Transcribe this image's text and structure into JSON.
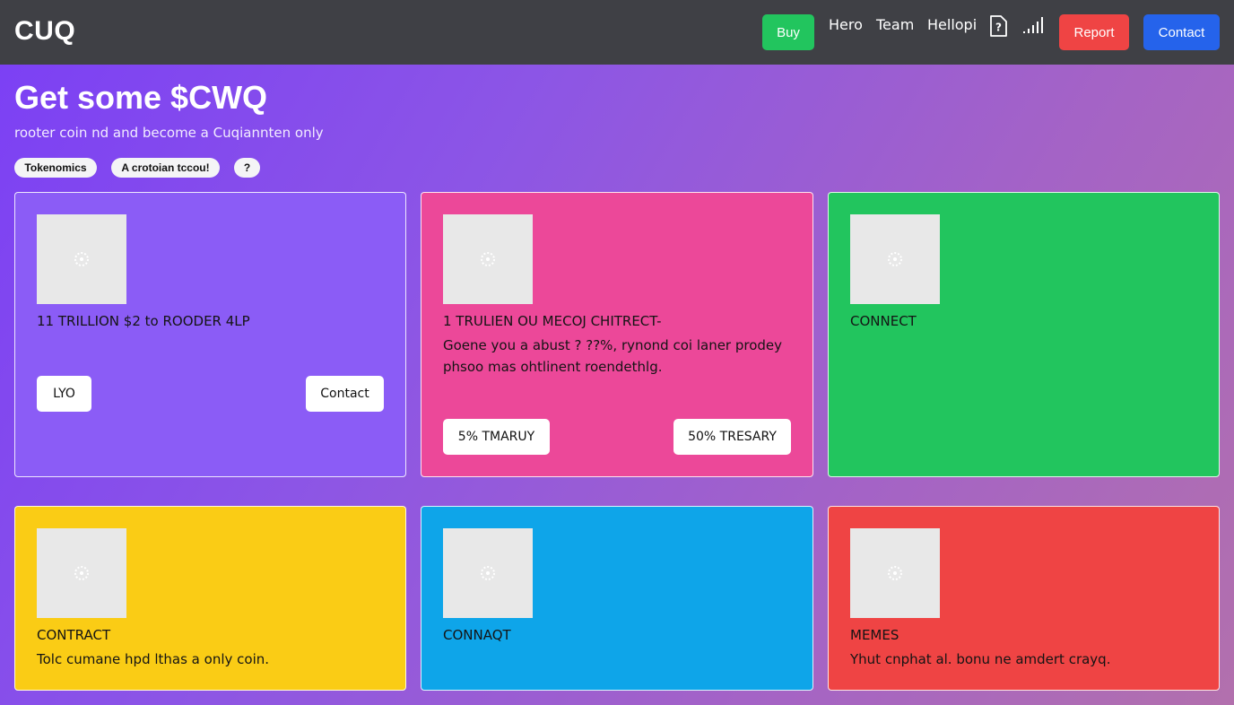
{
  "header": {
    "logo": "CUQ",
    "buy_label": "Buy",
    "nav": [
      "Hero",
      "Team",
      "Hellopi"
    ],
    "report_label": "Report",
    "contact_label": "Contact",
    "icons": [
      "document-question-icon",
      "signal-bars-icon"
    ],
    "colors": {
      "bar": "#3f4045",
      "buy": "#22c55e",
      "report": "#ef4444",
      "contact": "#2563eb"
    }
  },
  "hero": {
    "title": "Get some $CWQ",
    "subtitle": "rooter coin nd and become a Cuqiannten only",
    "pills": [
      "Tokenomics",
      "A crotoian tccou!",
      "?"
    ]
  },
  "cards": [
    {
      "color": "#8b5cf6",
      "title": "11 TRILLION $2 to ROODER 4LP",
      "body": "",
      "buttons": [
        "LYO",
        "Contact"
      ]
    },
    {
      "color": "#ec4899",
      "title": "1 TRULIEN OU MECOJ CHITRECT-",
      "body": "Goene you a abust ? ??%, rynond coi laner prodey phsoo mas ohtlinent roendethlg.",
      "buttons": [
        "5% TMARUY",
        "50% TRESARY"
      ]
    },
    {
      "color": "#22c55e",
      "title": "CONNECT",
      "body": "",
      "buttons": []
    },
    {
      "color": "#facc15",
      "title": "CONTRACT",
      "body": "Tolc cumane hpd lthas a only coin.",
      "buttons": []
    },
    {
      "color": "#0ea5e9",
      "title": "CONNAQT",
      "body": "",
      "buttons": []
    },
    {
      "color": "#ef4444",
      "title": "MEMES",
      "body": "Yhut cnphat al. bonu ne amdert crayq.",
      "buttons": []
    }
  ]
}
